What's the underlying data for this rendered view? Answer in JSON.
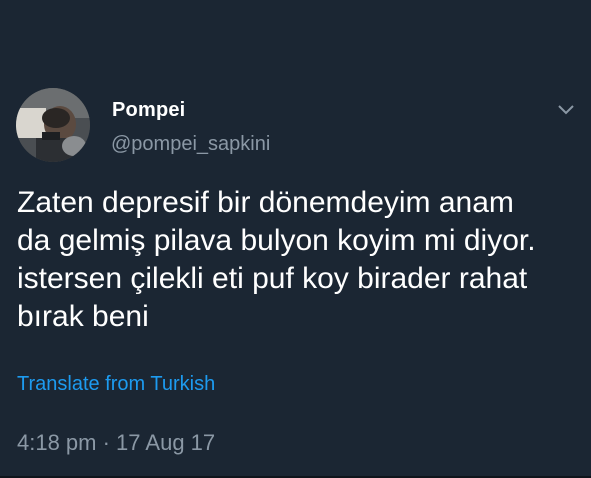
{
  "tweet": {
    "author": {
      "display_name": "Pompei",
      "handle": "@pompei_sapkini"
    },
    "text": "Zaten depresif bir dönemdeyim anam\nda gelmiş pilava bulyon koyim mi diyor.\nistersen çilekli eti puf koy birader rahat\nbırak beni",
    "translate_label": "Translate from Turkish",
    "timestamp": "4:18 pm · 17 Aug 17",
    "menu_icon": "chevron-down-icon"
  },
  "colors": {
    "background": "#1b2633",
    "primary_text": "#ffffff",
    "secondary_text": "#8b98a5",
    "link": "#1d9bf0"
  }
}
